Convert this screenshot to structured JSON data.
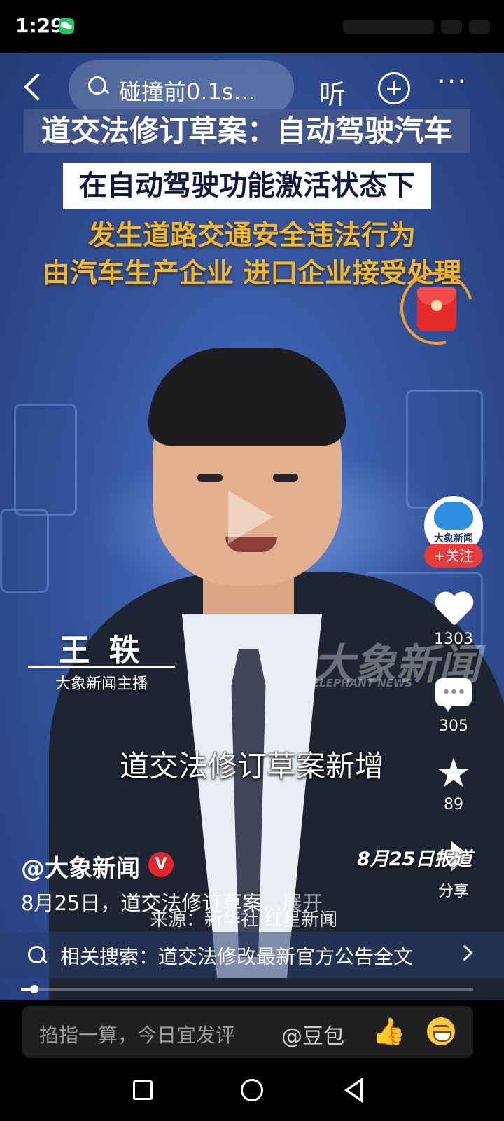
{
  "status_bar": {
    "time": "1:29"
  },
  "top_bar": {
    "search_query": "碰撞前0.1s…",
    "listen_label": "听",
    "more_label": "···"
  },
  "video": {
    "caption_line1": "道交法修订草案：自动驾驶汽车",
    "caption_line2": "在自动驾驶功能激活状态下",
    "caption_line3a": "发生道路交通安全违法行为",
    "caption_line3b": "由汽车生产企业 进口企业接受处理",
    "anchor_name": "王 轶",
    "anchor_title": "大象新闻主播",
    "watermark": "大象新闻",
    "watermark_sub": "ELEPHANT NEWS",
    "subtitle": "道交法修订草案新增",
    "date_report": "8月25日报道",
    "progress": 0.03
  },
  "sidebar": {
    "avatar_text": "大象新闻",
    "follow_label": "+关注",
    "likes": "1303",
    "comments": "305",
    "favorites": "89",
    "share_label": "分享"
  },
  "info": {
    "author": "@大象新闻",
    "verified": "V",
    "description": "8月25日，道交法修订草案...",
    "expand": "展开",
    "source": "来源：新华社 红星新闻",
    "related_search": "相关搜索：道交法修改最新官方公告全文"
  },
  "comment_bar": {
    "placeholder": "掐指一算，今日宜发评",
    "mention": "@豆包"
  },
  "colors": {
    "accent_red": "#e83b3b",
    "caption_yellow": "#f5b623"
  },
  "icons": [
    "back-icon",
    "search-icon",
    "add-icon",
    "more-icon",
    "red-packet-icon",
    "play-icon",
    "heart-icon",
    "comment-icon",
    "star-icon",
    "share-icon",
    "thumbs-up-icon",
    "grin-icon"
  ]
}
